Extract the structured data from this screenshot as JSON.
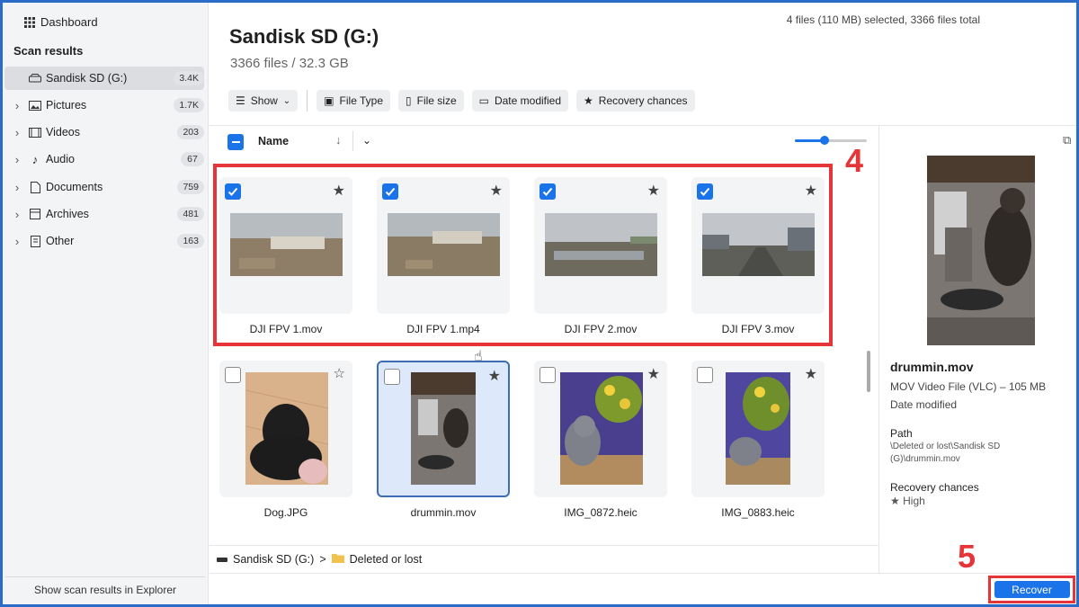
{
  "sidebar": {
    "dashboard": "Dashboard",
    "scan_results": "Scan results",
    "items": [
      {
        "label": "Sandisk SD (G:)",
        "count": "3.4K",
        "icon": "drive-icon"
      },
      {
        "label": "Pictures",
        "count": "1.7K",
        "icon": "pictures-icon"
      },
      {
        "label": "Videos",
        "count": "203",
        "icon": "videos-icon"
      },
      {
        "label": "Audio",
        "count": "67",
        "icon": "audio-icon"
      },
      {
        "label": "Documents",
        "count": "759",
        "icon": "documents-icon"
      },
      {
        "label": "Archives",
        "count": "481",
        "icon": "archives-icon"
      },
      {
        "label": "Other",
        "count": "163",
        "icon": "other-icon"
      }
    ],
    "bottom_button": "Show scan results in Explorer"
  },
  "header": {
    "title": "Sandisk SD (G:)",
    "subtitle": "3366 files / 32.3 GB",
    "filters": [
      "Show",
      "File Type",
      "File size",
      "Date modified",
      "Recovery chances"
    ]
  },
  "list": {
    "name_column": "Name",
    "sort_arrow": "↓"
  },
  "files": [
    {
      "name": "DJI FPV 1.mov",
      "checked": true
    },
    {
      "name": "DJI FPV 1.mp4",
      "checked": true
    },
    {
      "name": "DJI FPV 2.mov",
      "checked": true
    },
    {
      "name": "DJI FPV 3.mov",
      "checked": true
    },
    {
      "name": "Dog.JPG",
      "checked": false
    },
    {
      "name": "drummin.mov",
      "checked": false
    },
    {
      "name": "IMG_0872.heic",
      "checked": false
    },
    {
      "name": "IMG_0883.heic",
      "checked": false
    }
  ],
  "annotations": {
    "step4": "4",
    "step5": "5"
  },
  "path": {
    "drive": "Sandisk SD (G:)",
    "separator": ">",
    "folder": "Deleted or lost"
  },
  "status": {
    "text": "4 files (110 MB) selected, 3366 files total",
    "recover": "Recover"
  },
  "preview": {
    "name": "drummin.mov",
    "type": "MOV Video File (VLC) – 105 MB",
    "date_label": "Date modified",
    "path_label": "Path",
    "path_value": "\\Deleted or lost\\Sandisk SD (G)\\drummin.mov",
    "recovery_label": "Recovery chances",
    "recovery_value": "High"
  },
  "colors": {
    "accent": "#1a73e8",
    "highlight": "#e63538"
  }
}
